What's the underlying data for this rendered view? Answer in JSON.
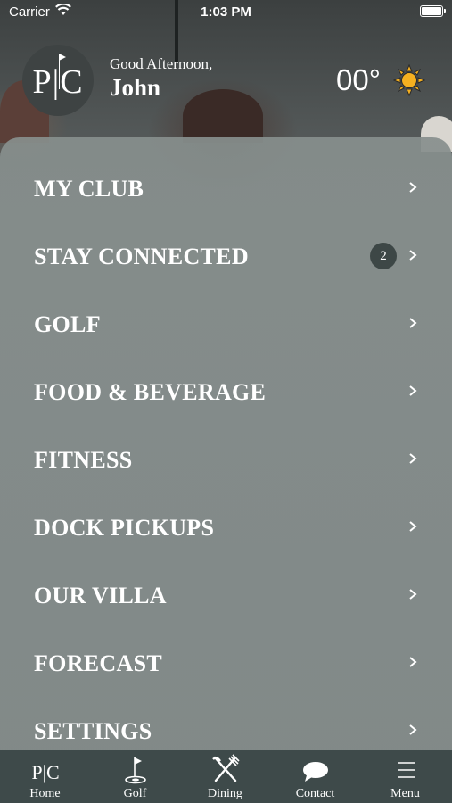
{
  "status_bar": {
    "carrier": "Carrier",
    "time": "1:03 PM"
  },
  "header": {
    "logo_text": "P|C",
    "greeting": "Good Afternoon,",
    "username": "John",
    "temperature": "00°",
    "weather_icon": "sun-icon"
  },
  "menu": {
    "items": [
      {
        "label": "MY CLUB"
      },
      {
        "label": "STAY CONNECTED",
        "badge": "2"
      },
      {
        "label": "GOLF"
      },
      {
        "label": "FOOD & BEVERAGE"
      },
      {
        "label": "FITNESS"
      },
      {
        "label": "DOCK PICKUPS"
      },
      {
        "label": "OUR VILLA"
      },
      {
        "label": "FORECAST"
      },
      {
        "label": "SETTINGS"
      }
    ]
  },
  "tabbar": {
    "tabs": [
      {
        "label": "Home",
        "icon": "pc-logo-icon"
      },
      {
        "label": "Golf",
        "icon": "golf-flag-icon"
      },
      {
        "label": "Dining",
        "icon": "fork-knife-icon"
      },
      {
        "label": "Contact",
        "icon": "chat-bubble-icon"
      },
      {
        "label": "Menu",
        "icon": "hamburger-icon"
      }
    ]
  },
  "colors": {
    "menu_background": "#878f8d",
    "tabbar_background": "#3e4a4a",
    "badge_background": "#3d4746",
    "sun_color": "#f5b020"
  }
}
